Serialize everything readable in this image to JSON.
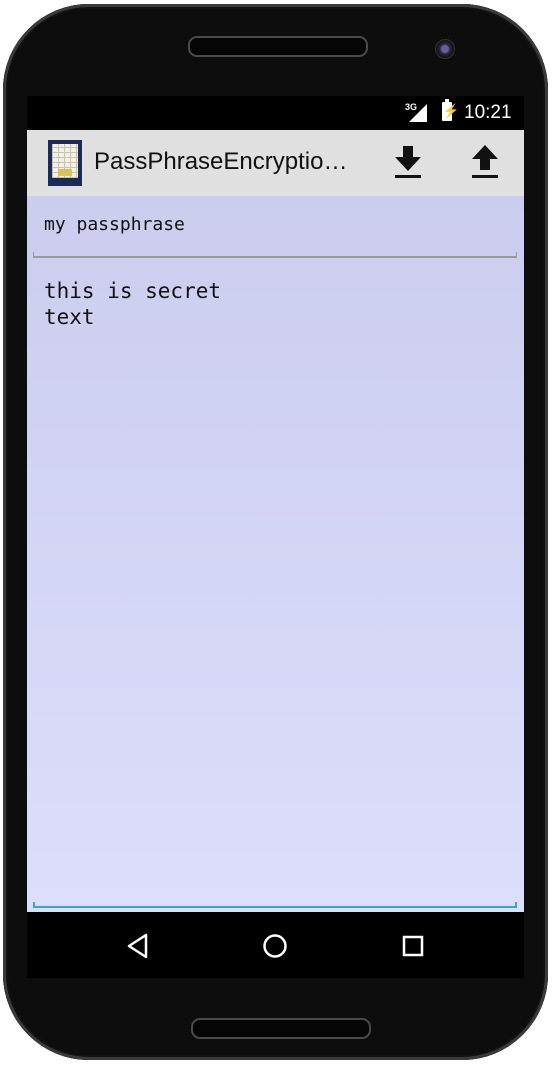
{
  "status_bar": {
    "network": "3G",
    "time": "10:21"
  },
  "action_bar": {
    "title": "PassPhraseEncryptio…",
    "icons": [
      "app-icon",
      "download-icon",
      "upload-icon"
    ]
  },
  "passphrase_field": {
    "value": "my passphrase"
  },
  "secret_field": {
    "value": "this is secret\ntext"
  },
  "nav_bar": {
    "icons": [
      "back-icon",
      "home-icon",
      "recents-icon"
    ]
  },
  "colors": {
    "action_bar_bg": "#e0e0e0",
    "content_bg_top": "#cccdee",
    "content_bg_bottom": "#dcdefb",
    "focus_accent": "#2fa8d8"
  }
}
